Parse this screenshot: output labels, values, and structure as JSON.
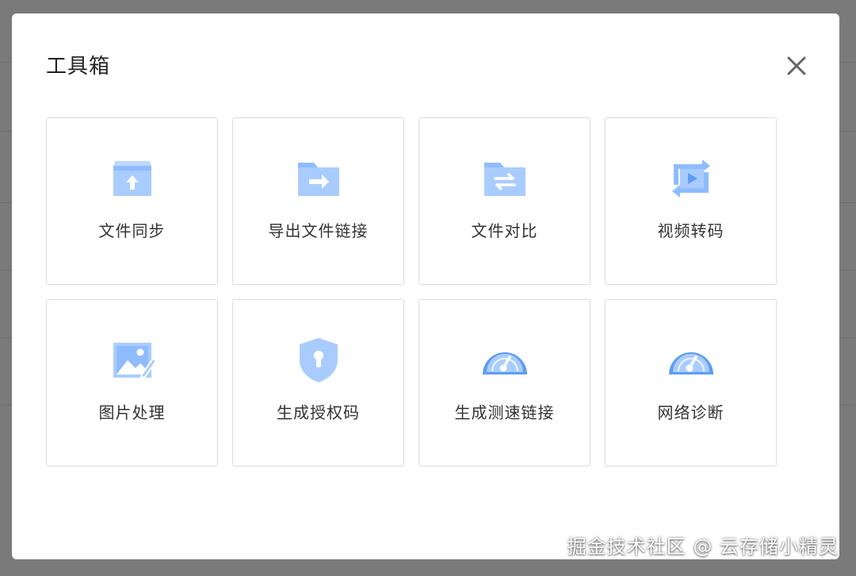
{
  "dialog": {
    "title": "工具箱",
    "close_icon": "close-icon"
  },
  "tools": [
    {
      "label": "文件同步",
      "icon": "folder-upload-icon"
    },
    {
      "label": "导出文件链接",
      "icon": "folder-export-icon"
    },
    {
      "label": "文件对比",
      "icon": "folder-compare-icon"
    },
    {
      "label": "视频转码",
      "icon": "video-convert-icon"
    },
    {
      "label": "图片处理",
      "icon": "image-edit-icon"
    },
    {
      "label": "生成授权码",
      "icon": "shield-key-icon"
    },
    {
      "label": "生成测速链接",
      "icon": "speedometer-icon"
    },
    {
      "label": "网络诊断",
      "icon": "speedometer-icon"
    }
  ],
  "watermark": "掘金技术社区 @ 云存储小精灵",
  "colors": {
    "icon_light": "#a9ccff",
    "icon_dark": "#5e9cf5",
    "overlay": "#7a7a7a",
    "tile_border": "#dcdcdc"
  }
}
